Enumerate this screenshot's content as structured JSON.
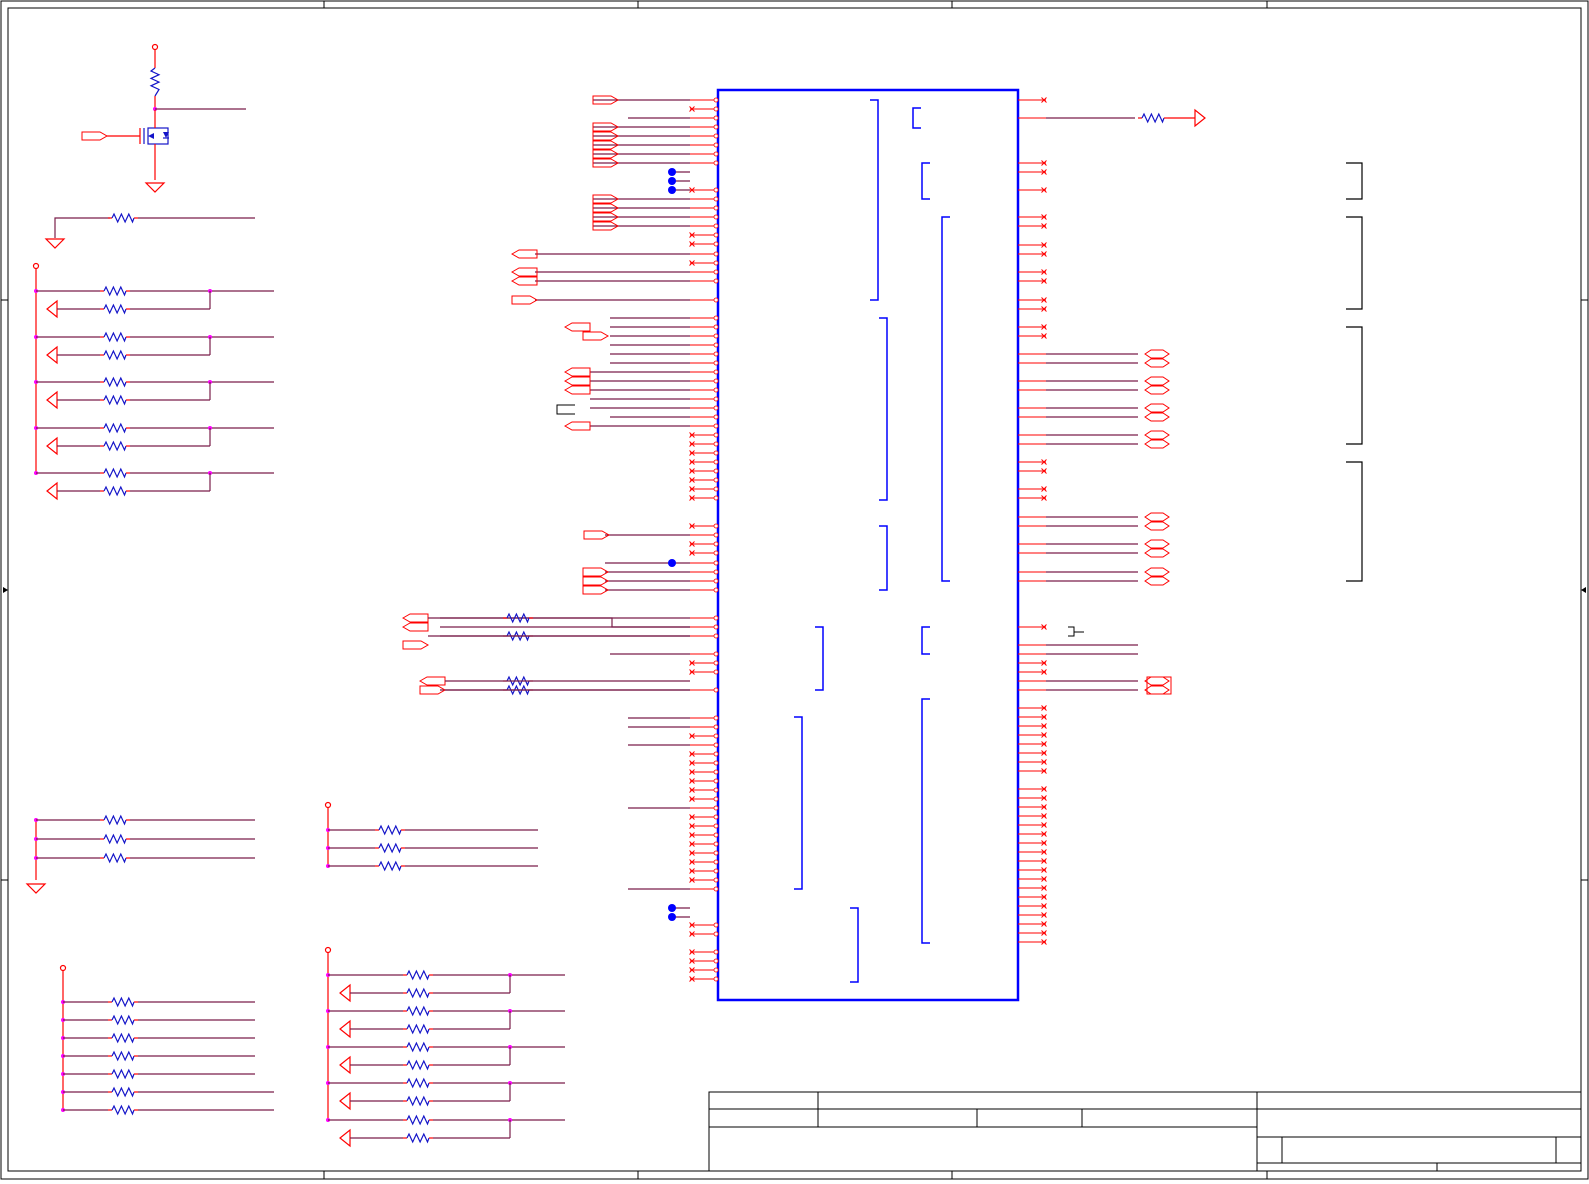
{
  "sheet": {
    "title": "",
    "colors": {
      "frame": "#000000",
      "wire": "#7a1e4a",
      "pin": "#ff0000",
      "resistor": "#1414c8",
      "ic_body": "#0000ff",
      "junction": "#ff00ff",
      "bus_dot": "#0000ff",
      "nc_mark": "#ff0000"
    },
    "icon_names": [
      "resistor-icon",
      "ground-icon",
      "power-port-icon",
      "net-port-icon",
      "mosfet-icon",
      "no-connect-icon",
      "junction-icon"
    ]
  },
  "title_block": {
    "title": "",
    "size": "",
    "document_number": "",
    "revision": "",
    "date": "",
    "sheet": "",
    "of": ""
  }
}
